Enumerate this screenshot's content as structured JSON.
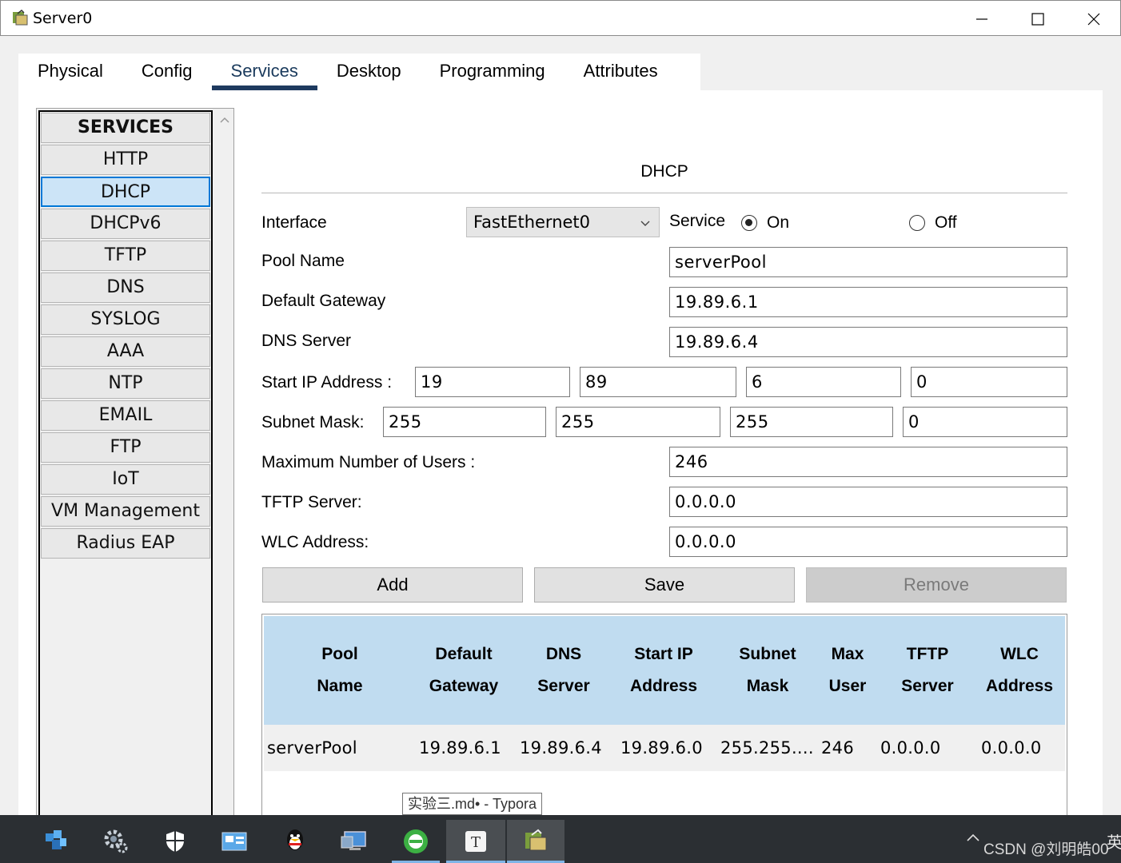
{
  "window": {
    "title": "Server0",
    "app_icon": "packet-tracer-server-icon"
  },
  "tabs": [
    "Physical",
    "Config",
    "Services",
    "Desktop",
    "Programming",
    "Attributes"
  ],
  "active_tab": "Services",
  "sidebar": {
    "header": "SERVICES",
    "items": [
      "HTTP",
      "DHCP",
      "DHCPv6",
      "TFTP",
      "DNS",
      "SYSLOG",
      "AAA",
      "NTP",
      "EMAIL",
      "FTP",
      "IoT",
      "VM Management",
      "Radius EAP"
    ],
    "selected": "DHCP"
  },
  "dhcp": {
    "title": "DHCP",
    "interface_label": "Interface",
    "interface_value": "FastEthernet0",
    "service_label": "Service",
    "on_label": "On",
    "off_label": "Off",
    "service_state": "On",
    "pool_name_label": "Pool Name",
    "pool_name": "serverPool",
    "gateway_label": "Default Gateway",
    "gateway": "19.89.6.1",
    "dns_label": "DNS Server",
    "dns": "19.89.6.4",
    "start_ip_label": "Start IP Address :",
    "start_ip": [
      "19",
      "89",
      "6",
      "0"
    ],
    "subnet_label": "Subnet Mask:",
    "subnet": [
      "255",
      "255",
      "255",
      "0"
    ],
    "max_users_label": "Maximum Number of Users :",
    "max_users": "246",
    "tftp_label": "TFTP Server:",
    "tftp": "0.0.0.0",
    "wlc_label": "WLC Address:",
    "wlc": "0.0.0.0",
    "buttons": {
      "add": "Add",
      "save": "Save",
      "remove": "Remove"
    }
  },
  "table": {
    "headers": [
      "Pool Name",
      "Default Gateway",
      "DNS Server",
      "Start IP Address",
      "Subnet Mask",
      "Max User",
      "TFTP Server",
      "WLC Address"
    ],
    "rows": [
      [
        "serverPool",
        "19.89.6.1",
        "19.89.6.4",
        "19.89.6.0",
        "255.255....",
        "246",
        "0.0.0.0",
        "0.0.0.0"
      ]
    ]
  },
  "tooltip": "实验三.md• - Typora",
  "taskbar": {
    "icons": [
      "cisco-packet-tracer-icon",
      "settings-gear-icon",
      "windows-security-icon",
      "control-panel-icon",
      "qq-penguin-icon",
      "remote-desktop-icon",
      "browser-icon",
      "typora-icon",
      "packet-tracer-active-icon"
    ],
    "tray_text": "CSDN @刘明皓00",
    "lang": "英"
  },
  "colors": {
    "accent": "#1e3a5f",
    "selected_bg": "#cce4f7",
    "table_header": "#c0dcf0",
    "taskbar": "#2b2f33"
  }
}
